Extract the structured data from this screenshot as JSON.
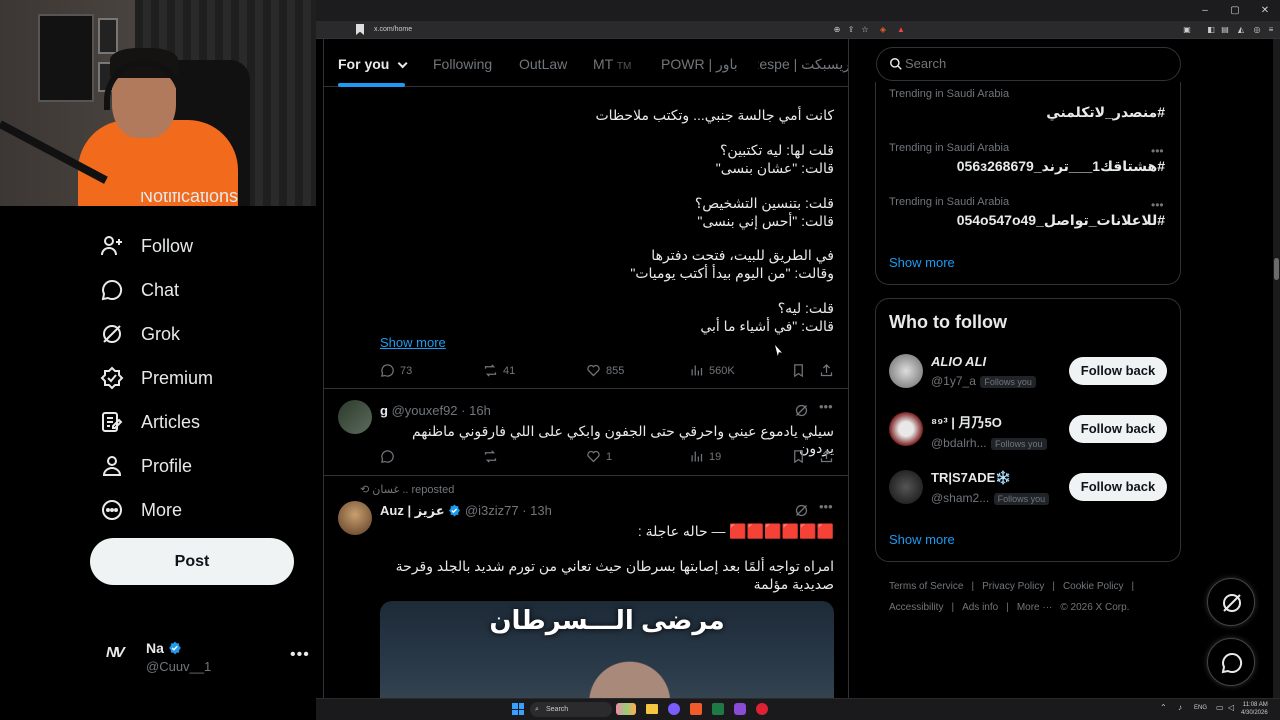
{
  "browser": {
    "url": "x.com/home",
    "window_controls": [
      "–",
      "▢",
      "✕"
    ]
  },
  "sidebar": {
    "partial_item": "Notifications",
    "items": [
      {
        "label": "Follow",
        "icon": "follow-icon"
      },
      {
        "label": "Chat",
        "icon": "chat-icon"
      },
      {
        "label": "Grok",
        "icon": "grok-icon"
      },
      {
        "label": "Premium",
        "icon": "premium-icon"
      },
      {
        "label": "Articles",
        "icon": "articles-icon"
      },
      {
        "label": "Profile",
        "icon": "profile-icon"
      },
      {
        "label": "More",
        "icon": "more-icon"
      }
    ],
    "post_label": "Post",
    "account": {
      "logo": "NV",
      "name": "Na",
      "handle": "@Cuuv__1",
      "more": "•••"
    }
  },
  "tabs": [
    {
      "label": "For you",
      "active": true
    },
    {
      "label": "Following"
    },
    {
      "label": "OutLaw"
    },
    {
      "label": "MT",
      "suffix": "TM"
    },
    {
      "label": "POWR | باور"
    },
    {
      "label": "ريسبكت | Respe"
    }
  ],
  "tweet1": {
    "lines": [
      "كانت أمي جالسة جنبي... وتكتب ملاحظات",
      "قلت لها: ليه تكتبين؟",
      "قالت: \"عشان بنسى\"",
      "قلت: بتنسين التشخيص؟",
      "قالت: \"أحس إني بنسى\"",
      "في الطريق للبيت، فتحت دفترها",
      "وقالت: \"من اليوم بيدأ أكتب يوميات\"",
      "قلت: ليه؟",
      "قالت: \"في أشياء ما أبي"
    ],
    "show_more": "Show more",
    "replies": "73",
    "reposts": "41",
    "likes": "855",
    "views": "560K"
  },
  "tweet2": {
    "name": "g",
    "handle": "@youxef92",
    "time": "· 16h",
    "text": "سيلي يادموع عيني واحرقي حتى الجفون وابكي على اللي فارقوني ماظنهم يردون",
    "likes": "1",
    "views": "19"
  },
  "tweet3": {
    "reposted_by": "غسان .. reposted",
    "name": "Auz | عزيز",
    "handle": "@i3ziz77",
    "time": "· 13h",
    "text1": "🟥🟥🟥🟥🟥🟥 — حاله عاجلة :",
    "text2": "امراه تواجه ألمًا بعد إصابتها بسرطان حيث تعاني من تورم شديد بالجلد وقرحة صديدية مؤلمة",
    "image_text": "مرضى الـــسرطان"
  },
  "search": {
    "placeholder": "Search"
  },
  "trends": [
    {
      "context": "Trending in Saudi Arabia",
      "tag": "#منصدر_لاتكلمني"
    },
    {
      "context": "Trending in Saudi Arabia",
      "tag": "#هشتاقك1___ترند_056з268679"
    },
    {
      "context": "Trending in Saudi Arabia",
      "tag": "#للاعلانات_تواصل_054о547о49"
    }
  ],
  "trends_more": "•••",
  "trends_show_more": "Show more",
  "who_to_follow": {
    "title": "Who to follow",
    "users": [
      {
        "name": "ALIO ALI",
        "handle": "@1y7_a",
        "badge": "Follows you",
        "button": "Follow back"
      },
      {
        "name": "⁸⁹³ | 月乃5O",
        "handle": "@bdalrh...",
        "badge": "Follows you",
        "button": "Follow back"
      },
      {
        "name": "TR|S7ADE❄️",
        "handle": "@sham2...",
        "badge": "Follows you",
        "button": "Follow back"
      }
    ],
    "show_more": "Show more"
  },
  "footer": {
    "links": [
      "Terms of Service",
      "|",
      "Privacy Policy",
      "|",
      "Cookie Policy",
      "|"
    ],
    "links2": [
      "Accessibility",
      "|",
      "Ads info",
      "|",
      "More ···",
      "© 2026 X Corp."
    ]
  },
  "taskbar": {
    "search": "Search",
    "lang": "ENG",
    "time": "11:08 AM",
    "date": "4/30/2026"
  },
  "colors": {
    "accent": "#1d9bf0",
    "background": "#000000",
    "border": "#2f3336",
    "muted": "#71767b"
  }
}
